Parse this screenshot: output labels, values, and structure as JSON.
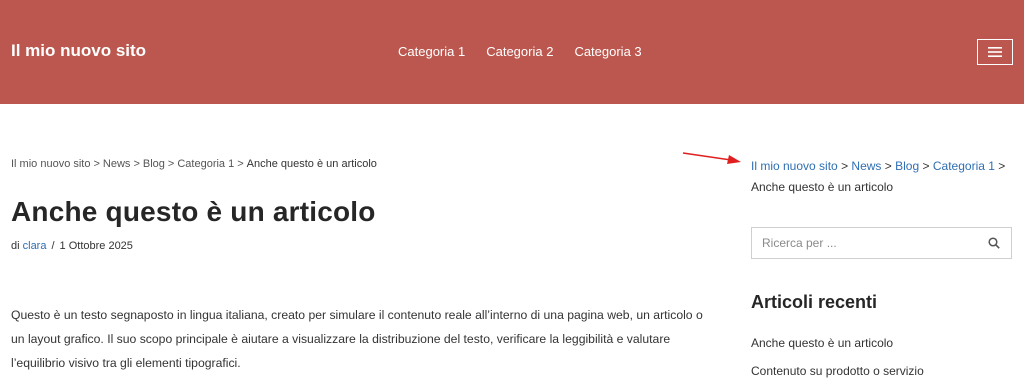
{
  "header": {
    "site_title": "Il mio nuovo sito",
    "nav": [
      {
        "label": "Categoria 1"
      },
      {
        "label": "Categoria 2"
      },
      {
        "label": "Categoria 3"
      }
    ],
    "menu_icon": "hamburger-menu-icon",
    "background_color": "#bb574e"
  },
  "breadcrumb": {
    "items": [
      "Il mio nuovo sito",
      "News",
      "Blog",
      "Categoria 1"
    ],
    "separator": ">",
    "current": "Anche questo è un articolo"
  },
  "post": {
    "title": "Anche questo è un articolo",
    "by_label": "di",
    "author": "clara",
    "meta_separator": "/",
    "date": "1 Ottobre 2025",
    "body": "Questo è un testo segnaposto in lingua italiana, creato per simulare il contenuto reale all’interno di una pagina web, un articolo o un layout grafico. Il suo scopo principale è aiutare a visualizzare la distribuzione del testo, verificare la leggibilità e valutare l’equilibrio visivo tra gli elementi tipografici."
  },
  "annotation": {
    "icon": "red-arrow-icon",
    "color": "#e02020"
  },
  "sidebar": {
    "breadcrumb": {
      "items": [
        "Il mio nuovo sito",
        "News",
        "Blog",
        "Categoria 1"
      ],
      "separator": ">",
      "current": "Anche questo è un articolo"
    },
    "search": {
      "placeholder": "Ricerca per ...",
      "icon": "search-icon"
    },
    "recent": {
      "title": "Articoli recenti",
      "items": [
        {
          "label": "Anche questo è un articolo"
        },
        {
          "label": "Contenuto su prodotto o servizio"
        }
      ]
    }
  },
  "colors": {
    "link": "#2f6fb2",
    "text": "#333333"
  }
}
